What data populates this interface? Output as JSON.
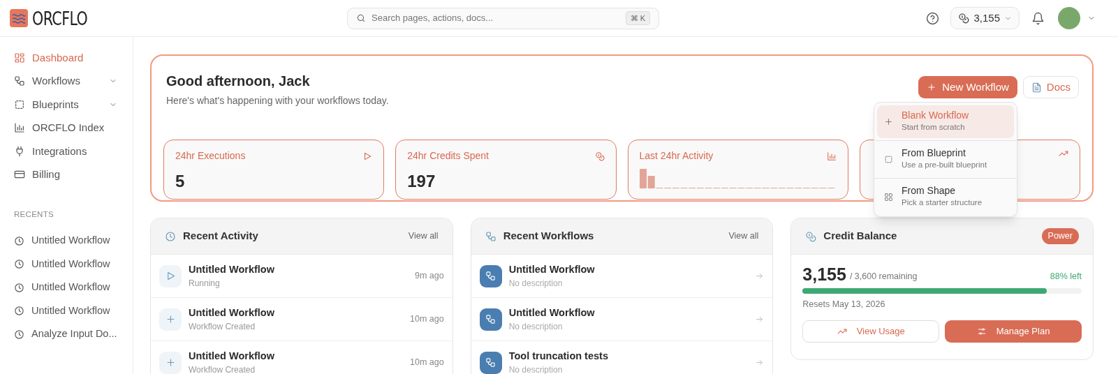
{
  "header": {
    "logo": "ORCFLO",
    "search": {
      "placeholder": "Search pages, actions, docs...",
      "shortcut": "⌘ K"
    },
    "credits": "3,155"
  },
  "sidebar": {
    "items": [
      {
        "label": "Dashboard",
        "selected": true,
        "has_submenu": false
      },
      {
        "label": "Workflows",
        "selected": false,
        "has_submenu": true
      },
      {
        "label": "Blueprints",
        "selected": false,
        "has_submenu": true
      },
      {
        "label": "ORCFLO Index",
        "selected": false,
        "has_submenu": false
      },
      {
        "label": "Integrations",
        "selected": false,
        "has_submenu": false
      },
      {
        "label": "Billing",
        "selected": false,
        "has_submenu": false
      }
    ],
    "recents_heading": "RECENTS",
    "recents": [
      "Untitled Workflow",
      "Untitled Workflow",
      "Untitled Workflow",
      "Untitled Workflow",
      "Analyze Input Do..."
    ]
  },
  "hero": {
    "greeting": "Good afternoon, Jack",
    "subtitle": "Here's what's happening with your workflows today.",
    "buttons": [
      {
        "label": "New Workflow",
        "kind": "primary"
      },
      {
        "label": "Docs",
        "kind": "secondary"
      }
    ],
    "menu": [
      {
        "label": "Blank Workflow",
        "description": "Start from scratch",
        "selected": true
      },
      {
        "label": "From Blueprint",
        "description": "Use a pre-built blueprint",
        "selected": false
      },
      {
        "label": "From Shape",
        "description": "Pick a starter structure",
        "selected": false
      }
    ],
    "stats": [
      {
        "kind": "number",
        "label": "24hr Executions",
        "value": "5"
      },
      {
        "kind": "number",
        "label": "24hr Credits Spent",
        "value": "197"
      },
      {
        "kind": "sparkline",
        "label": "Last 24hr Activity"
      },
      {
        "kind": "covered"
      }
    ]
  },
  "recent_activity": {
    "title": "Recent Activity",
    "link": "View all",
    "rows": [
      {
        "kind": "run",
        "title": "Untitled Workflow",
        "status": "Running",
        "time": "9m ago"
      },
      {
        "kind": "create",
        "title": "Untitled Workflow",
        "status": "Workflow Created",
        "time": "10m ago"
      },
      {
        "kind": "create",
        "title": "Untitled Workflow",
        "status": "Workflow Created",
        "time": "10m ago"
      }
    ]
  },
  "recent_workflows": {
    "title": "Recent Workflows",
    "link": "View all",
    "rows": [
      {
        "title": "Untitled Workflow",
        "description": "No description"
      },
      {
        "title": "Untitled Workflow",
        "description": "No description"
      },
      {
        "title": "Tool truncation tests",
        "description": "No description"
      }
    ]
  },
  "credit_balance": {
    "title": "Credit Balance",
    "plan": "Power",
    "amount": "3,155",
    "total": "/ 3,600 remaining",
    "percent_left": "88% left",
    "level": 0.875,
    "resets": "Resets May 13, 2026",
    "buttons": [
      {
        "label": "View Usage",
        "kind": "secondary"
      },
      {
        "label": "Manage Plan",
        "kind": "primary"
      }
    ]
  }
}
